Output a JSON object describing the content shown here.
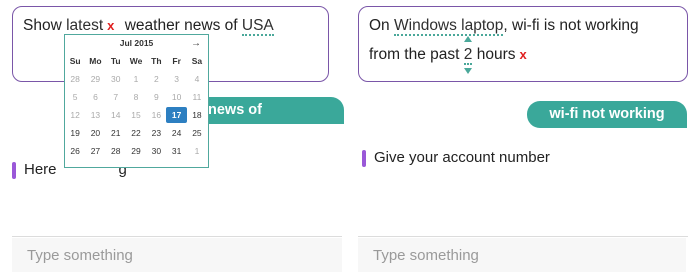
{
  "left": {
    "query": {
      "w1": "Show",
      "w2": "latest",
      "remove_mark": "x",
      "w3": "weather news of",
      "w4": "USA"
    },
    "bot_bubble": "news of hurricane",
    "reply_a": "Here",
    "reply_b": "g",
    "input_placeholder": "Type something"
  },
  "calendar": {
    "month_label": "Jul 2015",
    "next_arrow": "→",
    "weekdays": [
      "Su",
      "Mo",
      "Tu",
      "We",
      "Th",
      "Fr",
      "Sa"
    ],
    "weeks": [
      [
        "28",
        "29",
        "30",
        "1",
        "2",
        "3",
        "4"
      ],
      [
        "5",
        "6",
        "7",
        "8",
        "9",
        "10",
        "11"
      ],
      [
        "12",
        "13",
        "14",
        "15",
        "16",
        "17",
        "18"
      ],
      [
        "19",
        "20",
        "21",
        "22",
        "23",
        "24",
        "25"
      ],
      [
        "26",
        "27",
        "28",
        "29",
        "30",
        "31",
        "1"
      ]
    ],
    "selected": "17"
  },
  "right": {
    "query": {
      "w1": "On",
      "w2": "Windows laptop",
      "w3": ", wi-fi is not working",
      "w4": "from the past",
      "w5": "2",
      "w6": "hours",
      "remove_mark": "x"
    },
    "bot_bubble": "wi-fi not working",
    "reply": "Give your account number",
    "input_placeholder": "Type something"
  },
  "colors": {
    "accent_teal": "#3aa89a",
    "border_purple": "#7a56a8",
    "remove_red": "#e02020",
    "selected_blue": "#2d7fc1",
    "reply_bar": "#9a58d8"
  }
}
